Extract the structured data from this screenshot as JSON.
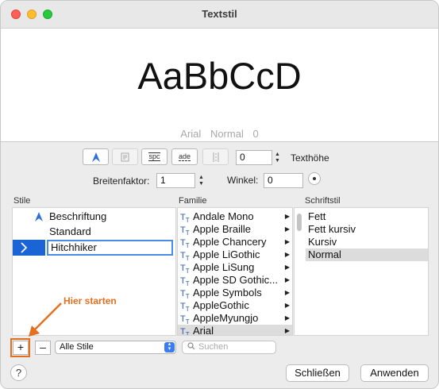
{
  "window": {
    "title": "Textstil"
  },
  "preview": {
    "sample_text": "AaBbCcD",
    "font_name": "Arial",
    "font_style": "Normal",
    "font_size": "0"
  },
  "toolbar": {
    "spc_label": "spc",
    "ade_label": "ade",
    "text_height_value": "0",
    "text_height_label": "Texthöhe",
    "width_factor_label": "Breitenfaktor:",
    "width_factor_value": "1",
    "angle_label": "Winkel:",
    "angle_value": "0"
  },
  "styles": {
    "header": "Stile",
    "items": [
      {
        "label": "Beschriftung",
        "icon": "annotative-icon"
      },
      {
        "label": "Standard"
      },
      {
        "label": "Hitchhiker",
        "editing": true
      }
    ]
  },
  "family": {
    "header": "Familie",
    "items": [
      "Andale Mono",
      "Apple Braille",
      "Apple Chancery",
      "Apple LiGothic",
      "Apple LiSung",
      "Apple SD Gothic...",
      "Apple Symbols",
      "AppleGothic",
      "AppleMyungjo",
      "Arial"
    ],
    "selected": "Arial"
  },
  "fontstyle": {
    "header": "Schriftstil",
    "items": [
      "Fett",
      "Fett kursiv",
      "Kursiv",
      "Normal"
    ],
    "selected": "Normal"
  },
  "bottom": {
    "add_label": "+",
    "remove_label": "–",
    "filter_value": "Alle Stile",
    "search_placeholder": "Suchen",
    "help_label": "?",
    "close_label": "Schließen",
    "apply_label": "Anwenden"
  },
  "annotation": {
    "text": "Hier starten"
  },
  "colors": {
    "accent": "#3a7cf4",
    "annotation": "#e46f1e",
    "selection": "#dcdcdc"
  }
}
